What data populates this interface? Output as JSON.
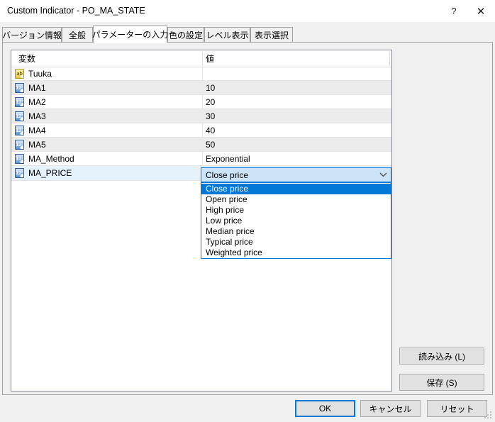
{
  "window": {
    "title": "Custom Indicator - PO_MA_STATE",
    "help_label": "?",
    "close_label": "✕"
  },
  "tabs": [
    {
      "label": "バージョン情報"
    },
    {
      "label": "全般"
    },
    {
      "label": "パラメーターの入力"
    },
    {
      "label": "色の設定"
    },
    {
      "label": "レベル表示"
    },
    {
      "label": "表示選択"
    }
  ],
  "grid": {
    "columns": {
      "name": "変数",
      "value": "値"
    },
    "rows": [
      {
        "icon": "string-variable-icon",
        "icon_text": "ab",
        "name": "Tuuka",
        "value": ""
      },
      {
        "icon": "number-variable-icon",
        "icon_text": "123",
        "name": "MA1",
        "value": "10"
      },
      {
        "icon": "number-variable-icon",
        "icon_text": "123",
        "name": "MA2",
        "value": "20"
      },
      {
        "icon": "number-variable-icon",
        "icon_text": "123",
        "name": "MA3",
        "value": "30"
      },
      {
        "icon": "number-variable-icon",
        "icon_text": "123",
        "name": "MA4",
        "value": "40"
      },
      {
        "icon": "number-variable-icon",
        "icon_text": "123",
        "name": "MA5",
        "value": "50"
      },
      {
        "icon": "number-variable-icon",
        "icon_text": "123",
        "name": "MA_Method",
        "value": "Exponential"
      },
      {
        "icon": "number-variable-icon",
        "icon_text": "123",
        "name": "MA_PRICE",
        "value": "Close price"
      }
    ]
  },
  "combobox": {
    "value": "Close price",
    "selected_index": 0,
    "options": [
      "Close price",
      "Open price",
      "High price",
      "Low price",
      "Median price",
      "Typical price",
      "Weighted price"
    ]
  },
  "side_buttons": {
    "load_label": "読み込み (L)",
    "save_label": "保存 (S)"
  },
  "footer_buttons": {
    "ok_label": "OK",
    "cancel_label": "キャンセル",
    "reset_label": "リセット"
  },
  "colors": {
    "accent": "#0078d7",
    "dialog_background": "#f0f0f0",
    "row_shaded": "#ebebeb",
    "row_selected": "#e5f1fb",
    "combo_background": "#cce4f7",
    "button_face": "#e1e1e1"
  }
}
